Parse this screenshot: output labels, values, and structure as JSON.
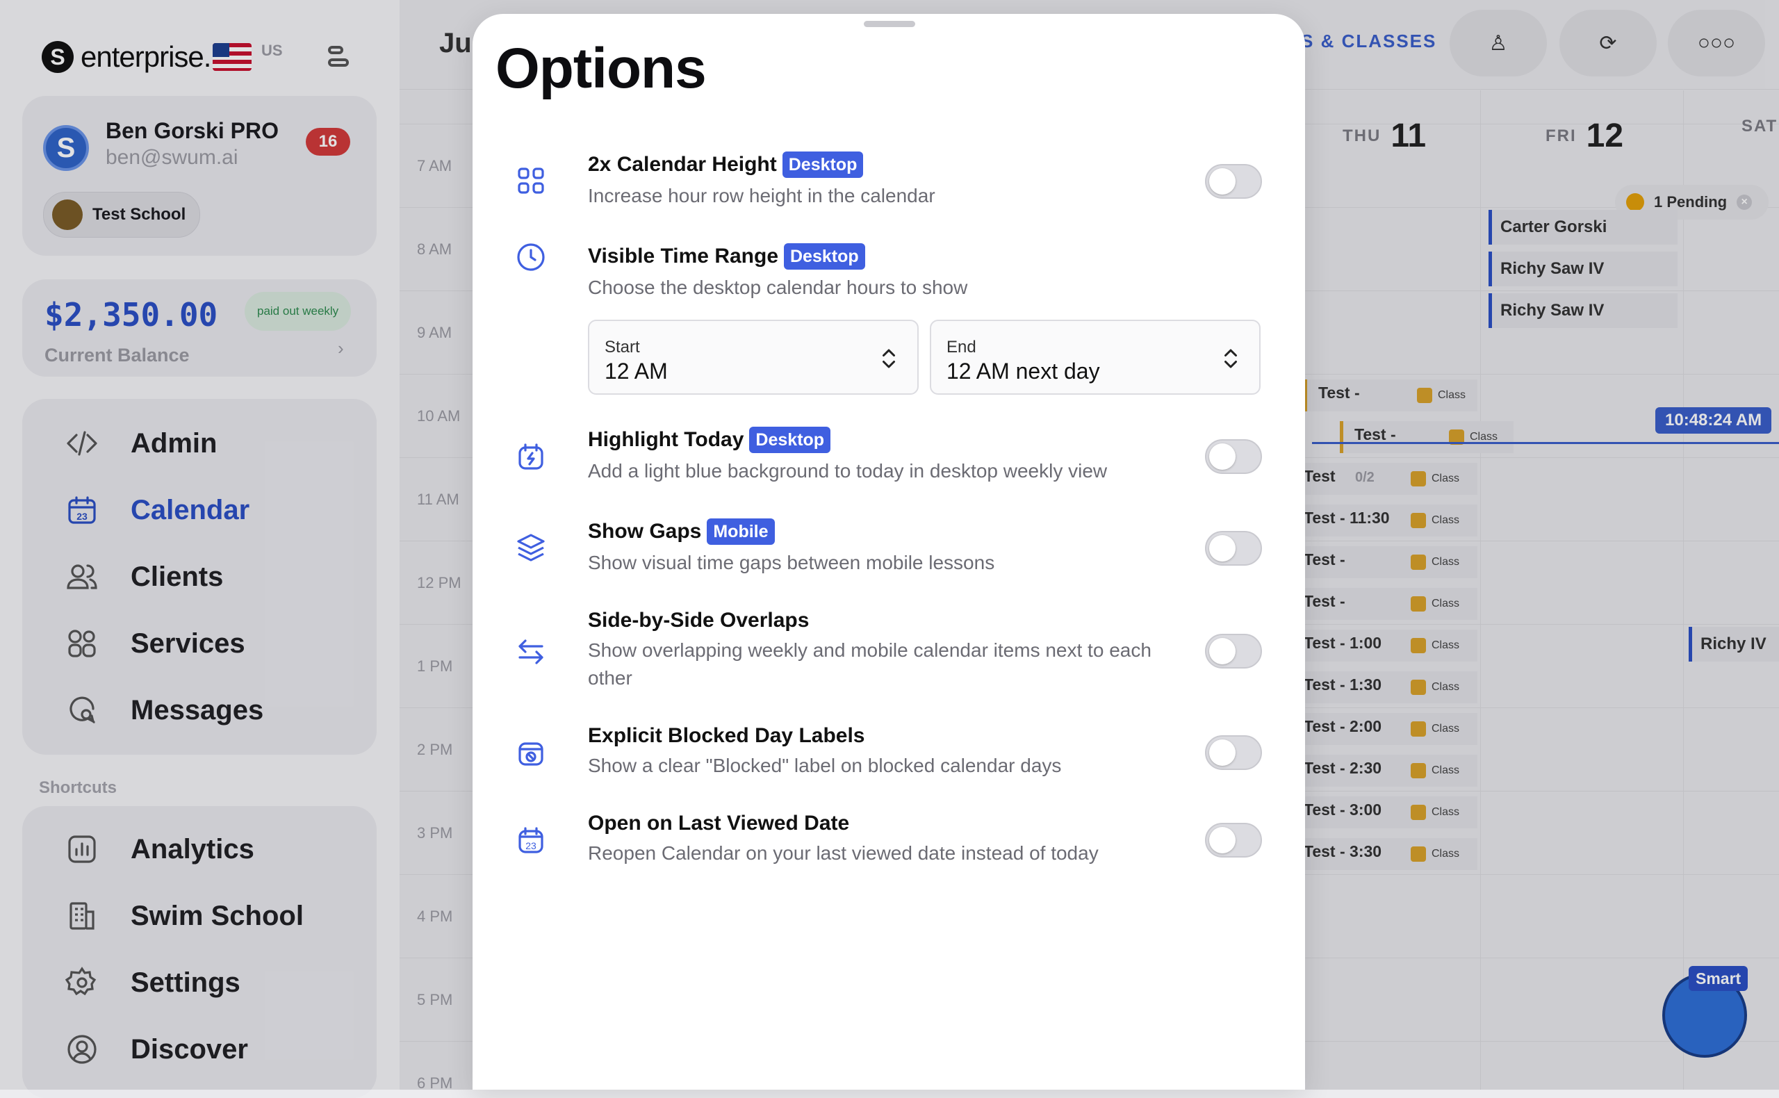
{
  "sidebar": {
    "logo_mark": "S",
    "brand": "enterprise.",
    "region": "US",
    "profile": {
      "avatar_letter": "S",
      "name": "Ben Gorski PRO",
      "email": "ben@swum.ai",
      "notifications": "16",
      "school": "Test School"
    },
    "balance": {
      "amount": "$2,350.00",
      "label": "Current Balance",
      "payout": "paid out weekly"
    },
    "nav": [
      {
        "label": "Admin",
        "icon": "code-icon",
        "active": false
      },
      {
        "label": "Calendar",
        "icon": "calendar-icon",
        "active": true
      },
      {
        "label": "Clients",
        "icon": "users-icon",
        "active": false
      },
      {
        "label": "Services",
        "icon": "shapes-icon",
        "active": false
      },
      {
        "label": "Messages",
        "icon": "chat-search-icon",
        "active": false
      }
    ],
    "shortcuts_label": "Shortcuts",
    "shortcuts": [
      {
        "label": "Analytics",
        "icon": "chart-icon"
      },
      {
        "label": "Swim School",
        "icon": "building-icon"
      },
      {
        "label": "Settings",
        "icon": "gear-icon"
      },
      {
        "label": "Discover",
        "icon": "user-search-icon"
      }
    ]
  },
  "calendar": {
    "header_partial": "Ju",
    "nav_link": "S & CLASSES",
    "hours": [
      "7 AM",
      "8 AM",
      "9 AM",
      "10 AM",
      "11 AM",
      "12 PM",
      "1 PM",
      "2 PM",
      "3 PM",
      "4 PM",
      "5 PM",
      "6 PM"
    ],
    "days": [
      {
        "weekday": "THU",
        "date": "11"
      },
      {
        "weekday": "FRI",
        "date": "12"
      },
      {
        "weekday": "SAT",
        "date": ""
      }
    ],
    "pending": "1 Pending",
    "friday_events": [
      "Carter Gorski",
      "Richy Saw IV",
      "Richy Saw IV"
    ],
    "saturday_event": "Richy IV",
    "class_tag": "Class",
    "class_events": [
      "Test -",
      "Test -",
      "Test",
      "Test - 11:30",
      "Test -",
      "Test -",
      "Test - 1:00",
      "Test - 1:30",
      "Test - 2:00",
      "Test - 2:30",
      "Test - 3:00",
      "Test - 3:30"
    ],
    "class_count": "0/2",
    "current_time": "10:48:24 AM",
    "assistant_label": "Smart"
  },
  "modal": {
    "title": "Options",
    "options": [
      {
        "title": "2x Calendar Height",
        "badge": "Desktop",
        "desc": "Increase hour row height in the calendar",
        "icon": "grid-icon",
        "enabled": false
      },
      {
        "title": "Visible Time Range",
        "badge": "Desktop",
        "desc": "Choose the desktop calendar hours to show",
        "icon": "clock-icon"
      },
      {
        "title": "Highlight Today",
        "badge": "Desktop",
        "desc": "Add a light blue background to today in desktop weekly view",
        "icon": "calendar-bolt-icon",
        "enabled": false
      },
      {
        "title": "Show Gaps",
        "badge": "Mobile",
        "desc": "Show visual time gaps between mobile lessons",
        "icon": "layers-icon",
        "enabled": false
      },
      {
        "title": "Side-by-Side Overlaps",
        "badge": "",
        "desc": "Show overlapping weekly and mobile calendar items next to each other",
        "icon": "arrows-swap-icon",
        "enabled": false
      },
      {
        "title": "Explicit Blocked Day Labels",
        "badge": "",
        "desc": "Show a clear \"Blocked\" label on blocked calendar days",
        "icon": "calendar-blocked-icon",
        "enabled": false
      },
      {
        "title": "Open on Last Viewed Date",
        "badge": "",
        "desc": "Reopen Calendar on your last viewed date instead of today",
        "icon": "calendar-23-icon",
        "enabled": false
      }
    ],
    "time_range": {
      "start": {
        "label": "Start",
        "value": "12 AM"
      },
      "end": {
        "label": "End",
        "value": "12 AM next day"
      }
    }
  },
  "colors": {
    "accent": "#3f5fe0",
    "brand_blue": "#2b4fc4",
    "toggle_off": "#dcdce1"
  }
}
